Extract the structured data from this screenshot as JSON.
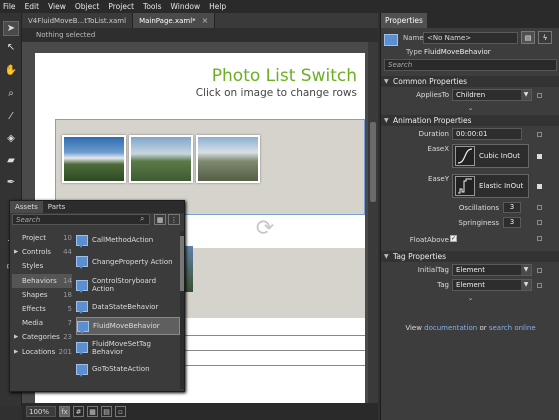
{
  "menu": [
    "File",
    "Edit",
    "View",
    "Object",
    "Project",
    "Tools",
    "Window",
    "Help"
  ],
  "doc_tabs": [
    {
      "label": "V4FluidMoveB...tToList.xaml"
    },
    {
      "label": "MainPage.xaml*"
    }
  ],
  "breadcrumb": "Nothing selected",
  "artboard": {
    "title": "Photo List Switch",
    "subtitle": "Click on image to change rows"
  },
  "status": {
    "zoom": "100%"
  },
  "assets": {
    "tabs": [
      "Assets",
      "Parts"
    ],
    "search_placeholder": "Search",
    "categories": [
      {
        "label": "Project",
        "count": "10",
        "arrow": ""
      },
      {
        "label": "Controls",
        "count": "44",
        "arrow": "▶"
      },
      {
        "label": "Styles",
        "count": "",
        "arrow": ""
      },
      {
        "label": "Behaviors",
        "count": "14",
        "arrow": ""
      },
      {
        "label": "Shapes",
        "count": "18",
        "arrow": ""
      },
      {
        "label": "Effects",
        "count": "5",
        "arrow": ""
      },
      {
        "label": "Media",
        "count": "7",
        "arrow": ""
      },
      {
        "label": "Categories",
        "count": "23",
        "arrow": "▶"
      },
      {
        "label": "Locations",
        "count": "201",
        "arrow": "▶"
      }
    ],
    "items": [
      "CallMethodAction",
      "ChangeProperty Action",
      "ControlStoryboard Action",
      "DataStateBehavior",
      "FluidMoveBehavior",
      "FluidMoveSetTag Behavior",
      "GoToStateAction"
    ]
  },
  "properties": {
    "tab": "Properties",
    "name_label": "Name",
    "name_value": "<No Name>",
    "type_label": "Type",
    "type_value": "FluidMoveBehavior",
    "search_placeholder": "Search",
    "sections": {
      "common": "Common Properties",
      "animation": "Animation Properties",
      "tag": "Tag Properties"
    },
    "applies_to": {
      "label": "AppliesTo",
      "value": "Children"
    },
    "duration": {
      "label": "Duration",
      "value": "00:00:01"
    },
    "easex": {
      "label": "EaseX",
      "value": "Cubic InOut"
    },
    "easey": {
      "label": "EaseY",
      "value": "Elastic InOut"
    },
    "oscillations": {
      "label": "Oscillations",
      "value": "3"
    },
    "springiness": {
      "label": "Springiness",
      "value": "3"
    },
    "float_above": {
      "label": "FloatAbove",
      "checked": true
    },
    "initial_tag": {
      "label": "InitialTag",
      "value": "Element"
    },
    "tag": {
      "label": "Tag",
      "value": "Element"
    },
    "footer": {
      "prefix": "View",
      "link1": "documentation",
      "mid": "or",
      "link2": "search online"
    }
  }
}
